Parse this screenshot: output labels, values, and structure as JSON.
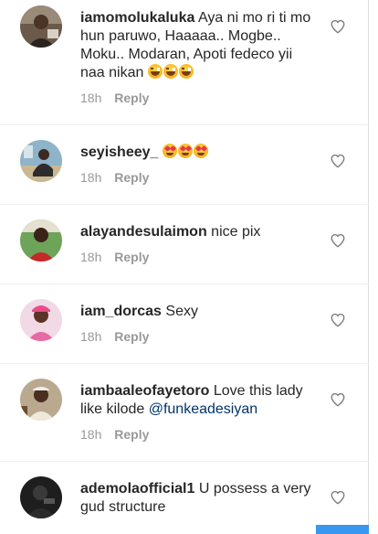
{
  "comments": [
    {
      "username": "iamomolukaluka",
      "text": "Aya ni mo ri ti mo hun paruwo, Haaaaa.. Mogbe.. Moku.. Modaran, Apoti fedeco yii naa nikan",
      "emojis": [
        "laughing-crying",
        "laughing-crying",
        "laughing-crying"
      ],
      "time": "18h",
      "reply": "Reply"
    },
    {
      "username": "seyisheey_",
      "text": "",
      "emojis": [
        "heart-eyes",
        "heart-eyes",
        "heart-eyes"
      ],
      "time": "18h",
      "reply": "Reply"
    },
    {
      "username": "alayandesulaimon",
      "text": "nice pix",
      "time": "18h",
      "reply": "Reply"
    },
    {
      "username": "iam_dorcas",
      "text": "Sexy",
      "time": "18h",
      "reply": "Reply"
    },
    {
      "username": "iambaaleofayetoro",
      "text": "Love this lady like kilode",
      "mention": "@funkeadesiyan",
      "time": "18h",
      "reply": "Reply"
    },
    {
      "username": "ademolaofficial1",
      "text": "U possess a very gud structure",
      "time": "",
      "reply": ""
    }
  ],
  "colors": {
    "text": "#262626",
    "meta": "#999999",
    "mention": "#003569",
    "accent": "#3897f0"
  },
  "icons": {
    "like": "heart-outline-icon"
  }
}
